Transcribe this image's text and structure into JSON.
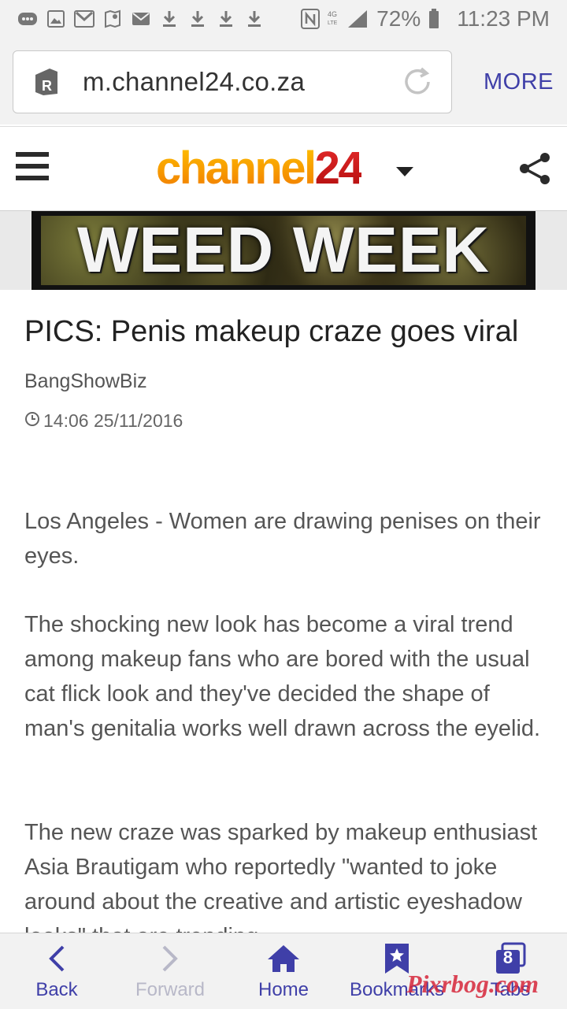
{
  "status_bar": {
    "battery": "72%",
    "time": "11:23 PM"
  },
  "browser": {
    "url": "m.channel24.co.za",
    "more_label": "MORE"
  },
  "site": {
    "logo_part1": "channel",
    "logo_part2": "24",
    "banner_text": "WEED WEEK"
  },
  "article": {
    "title": "PICS: Penis makeup craze goes viral",
    "byline": "BangShowBiz",
    "timestamp": "14:06 25/11/2016",
    "paragraphs": [
      "Los Angeles - Women are drawing penises on their eyes.",
      "The shocking new look has become a viral trend among makeup fans who are bored with the usual cat flick look and they've decided the shape of man's genitalia works well drawn across the eyelid.",
      "The new craze was sparked by makeup enthusiast Asia Brautigam who reportedly \"wanted to joke around about the creative and artistic eyeshadow looks\" that are trending"
    ]
  },
  "bottom_nav": {
    "back": "Back",
    "forward": "Forward",
    "home": "Home",
    "bookmarks": "Bookmarks",
    "tabs": "Tabs",
    "tab_count": "8"
  },
  "watermark": "Pixrbog.com",
  "colors": {
    "accent": "#3f3fa8",
    "logo_orange": "#f7a21b",
    "logo_red": "#d42020"
  }
}
